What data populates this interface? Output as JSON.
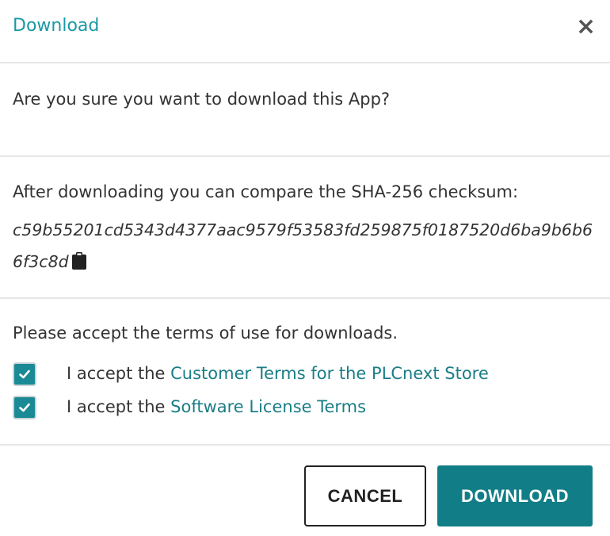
{
  "dialog": {
    "title": "Download",
    "close_label": "×"
  },
  "confirm": {
    "text": "Are you sure you want to download this App?"
  },
  "checksum": {
    "intro": "After downloading you can compare the SHA-256 checksum:",
    "hash": "c59b55201cd5343d4377aac9579f53583fd259875f0187520d6ba9b6b66f3c8d",
    "copy_icon": "clipboard-icon"
  },
  "terms": {
    "intro": "Please accept the terms of use for downloads.",
    "items": [
      {
        "prefix": "I accept the ",
        "link": "Customer Terms for the PLCnext Store",
        "checked": true
      },
      {
        "prefix": "I accept the ",
        "link": "Software License Terms",
        "checked": true
      }
    ]
  },
  "buttons": {
    "cancel": "CANCEL",
    "download": "DOWNLOAD"
  },
  "colors": {
    "accent": "#1a9aa6",
    "primary_button": "#117d86",
    "link": "#1a7d86",
    "checkbox": "#1a8a94"
  }
}
